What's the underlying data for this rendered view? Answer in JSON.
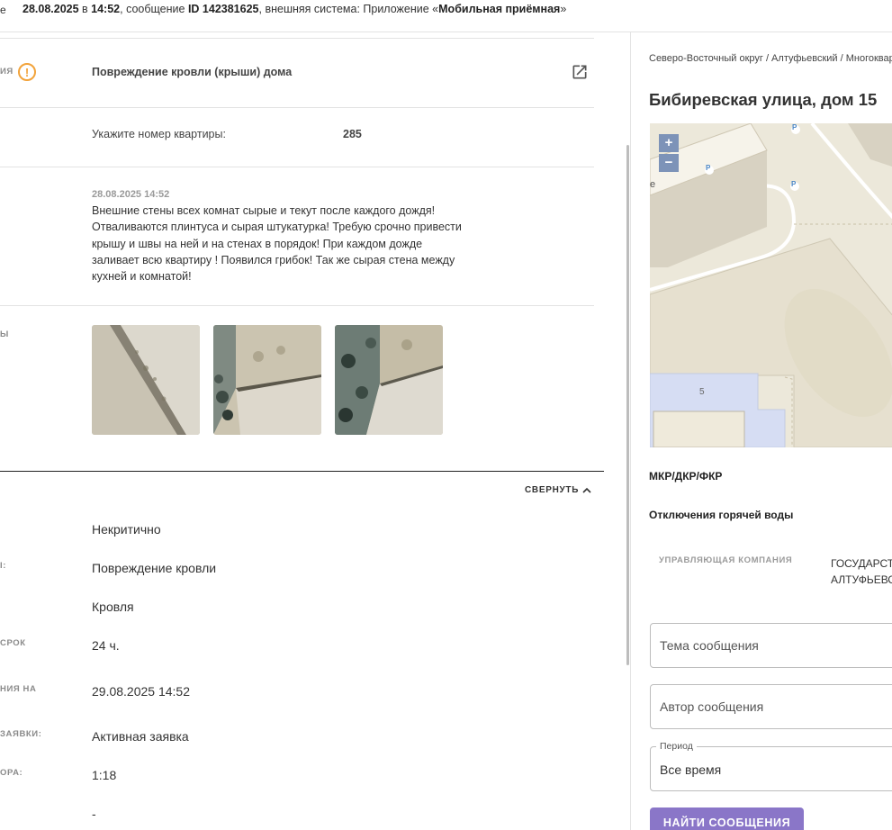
{
  "topbar": {
    "cut_text": "е",
    "date": "28.08.2025",
    "in_word": " в ",
    "time": "14:52",
    "msg_prefix": ", сообщение ",
    "msg_id": "ID 142381625",
    "system_prefix": ", внешняя система: Приложение «",
    "system_name": "Мобильная приёмная",
    "system_suffix": "»"
  },
  "issue": {
    "cut_label": "ия",
    "title": "Повреждение кровли (крыши) дома",
    "apartment_label": "Укажите номер квартиры:",
    "apartment_value": "285",
    "message_date": "28.08.2025 14:52",
    "message_text": "Внешние стены всех комнат сырые и текут после каждого дождя! Отваливаются плинтуса и сырая штукатурка! Требую срочно привести крышу и швы на ней и на стенах в порядок! При каждом дожде заливает всю квартиру ! Появился грибок! Так же сырая стена между кухней и комнатой!",
    "photos_cut_label": "ы"
  },
  "details": {
    "collapse_label": "СВЕРНУТЬ",
    "rows": [
      {
        "label": "",
        "value": "Некритично"
      },
      {
        "label": "I:",
        "value": "Повреждение кровли"
      },
      {
        "label": "",
        "value": "Кровля"
      },
      {
        "label": "СРОК",
        "value": "24 ч."
      },
      {
        "label": "НИЯ НА",
        "value": "29.08.2025 14:52"
      },
      {
        "label": "ЗАЯВКИ:",
        "value": "Активная заявка"
      },
      {
        "label": "ОРА:",
        "value": "1:18"
      },
      {
        "label": "",
        "value": "-"
      }
    ]
  },
  "right": {
    "breadcrumb": "Северо-Восточный округ / Алтуфьевский / Многоквартирные дома",
    "address": "Бибиревская улица, дом 15",
    "map": {
      "zoom_in": "+",
      "zoom_out": "−",
      "building_number": "5",
      "parking_marker": "P",
      "street_fragment": "е"
    },
    "sections": {
      "programs": "МКР/ДКР/ФКР",
      "hot_water": "Отключения горячей воды"
    },
    "uk_label": "УПРАВЛЯЮЩАЯ КОМПАНИЯ",
    "uk_value_line1": "ГОСУДАРСТВЕННОЕ БЮДЖЕТНОЕ",
    "uk_value_line2": "АЛТУФЬЕВСКИЙ",
    "form": {
      "topic_placeholder": "Тема сообщения",
      "author_placeholder": "Автор сообщения",
      "period_legend": "Период",
      "period_value": "Все время",
      "submit": "НАЙТИ СООБЩЕНИЯ"
    }
  },
  "colors": {
    "accent_button": "#8a76c8",
    "warning": "#f2a33a",
    "map_zoom": "#7d93b8"
  }
}
